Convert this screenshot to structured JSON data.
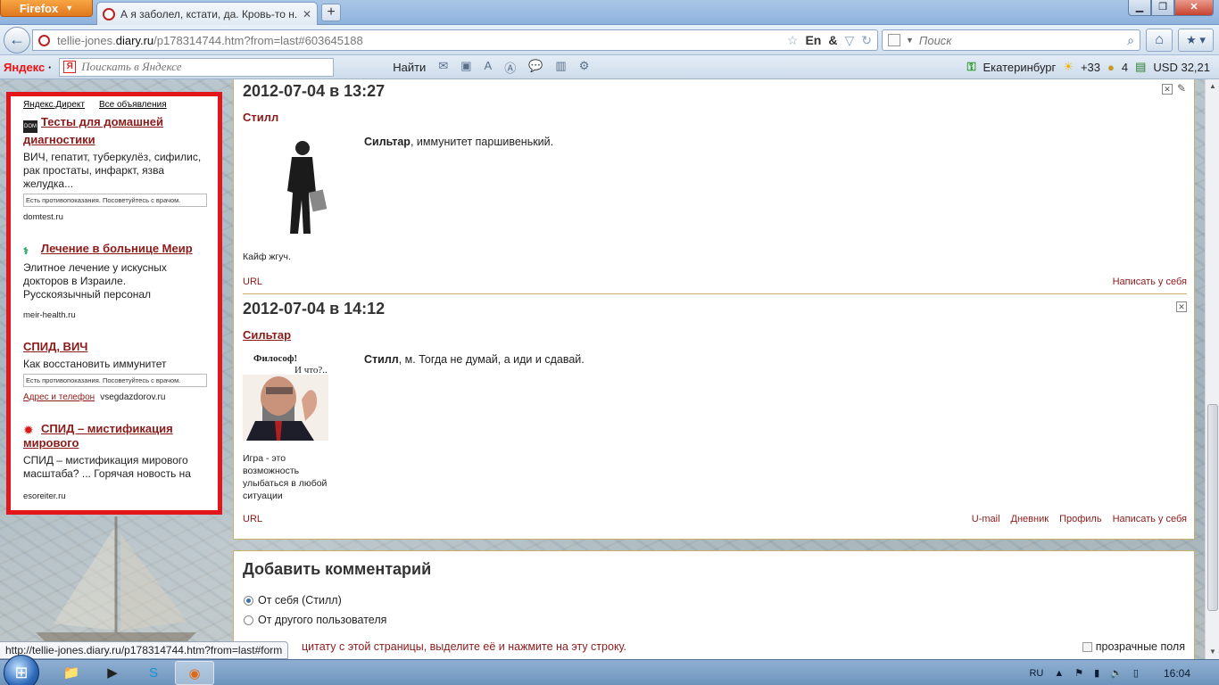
{
  "browser": {
    "app_button": "Firefox",
    "tab_title": "А я заболел, кстати, да. Кровь-то н...",
    "url_prefix": "tellie-jones.",
    "url_domain": "diary.ru",
    "url_rest": "/p178314744.htm?from=last#603645188",
    "search_placeholder": "Поиск",
    "status_url": "http://tellie-jones.diary.ru/p178314744.htm?from=last#form"
  },
  "yandex_bar": {
    "logo": "Яндекс",
    "search_placeholder": "Поискать в Яндексе",
    "find_label": "Найти",
    "city": "Екатеринбург",
    "temperature": "+33",
    "coins": "4",
    "currency": "USD 32,21"
  },
  "ads": {
    "header_direct": "Яндекс.Директ",
    "header_all": "Все объявления",
    "items": [
      {
        "title": "Тесты для домашней диагностики",
        "desc": "ВИЧ, гепатит, туберкулёз, сифилис, рак простаты, инфаркт, язва желудка...",
        "warning": "Есть противопоказания. Посоветуйтесь с врачом.",
        "domain": "domtest.ru"
      },
      {
        "title": "Лечение в больнице Меир",
        "desc": "Элитное лечение у искусных докторов в Израиле. Русскоязычный персонал",
        "domain": "meir-health.ru"
      },
      {
        "title": "СПИД, ВИЧ",
        "desc": "Как восстановить иммунитет",
        "warning": "Есть противопоказания. Посоветуйтесь с врачом.",
        "address_label": "Адрес и телефон",
        "domain": "vsegdazdorov.ru"
      },
      {
        "title": "СПИД – мистификация мирового",
        "desc": "СПИД – мистификация мирового масштаба? ... Горячая новость на",
        "domain": "esoreiter.ru"
      }
    ]
  },
  "posts": [
    {
      "date": "2012-07-04 в 13:27",
      "author": "Стилл",
      "avatar_caption": "Кайф жгуч.",
      "addressee": "Сильтар",
      "text": ", иммунитет паршивенький.",
      "url_label": "URL",
      "links": [
        "Написать у себя"
      ]
    },
    {
      "date": "2012-07-04 в 14:12",
      "author": "Сильтар",
      "avatar_line1": "Философ!",
      "avatar_line2": "И что?..",
      "avatar_caption": "Игра - это возможность улыбаться в любой ситуации",
      "addressee": "Стилл",
      "text": ", м. Тогда не думай, а иди и сдавай.",
      "url_label": "URL",
      "links": [
        "U-mail",
        "Дневник",
        "Профиль",
        "Написать у себя"
      ]
    }
  ],
  "comment_form": {
    "title": "Добавить комментарий",
    "option_self": "От себя (Стилл)",
    "option_other": "От другого пользователя",
    "quote_hint": "цитату с этой страницы, выделите её и нажмите на эту строку.",
    "transparent_fields": "прозрачные поля"
  },
  "taskbar": {
    "lang": "RU",
    "time": "16:04"
  }
}
